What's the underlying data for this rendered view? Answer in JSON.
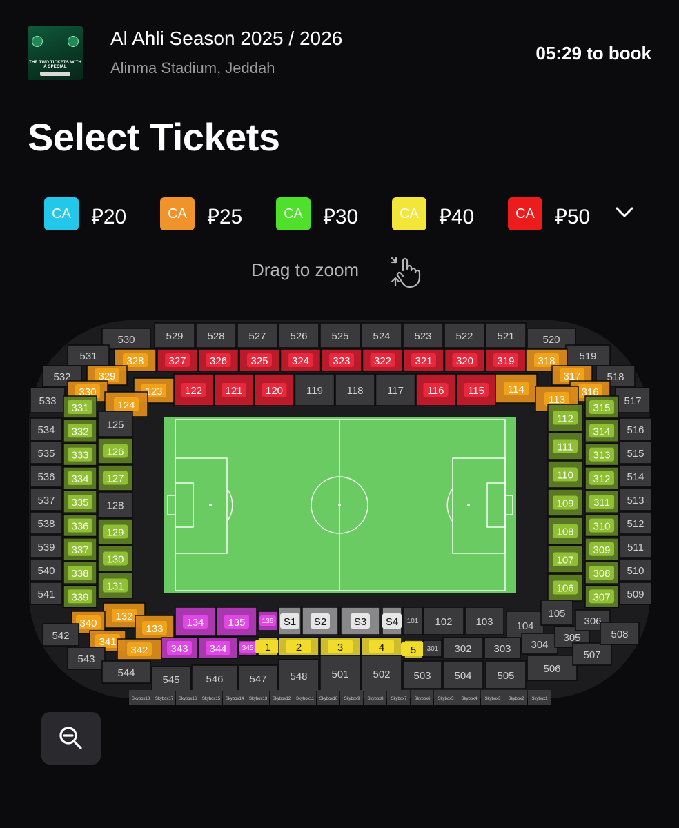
{
  "event": {
    "title": "Al Ahli Season 2025 / 2026",
    "venue": "Alinma Stadium, Jeddah",
    "timer": "05:29 to book",
    "thumbnail_text": "THE TWO TICKETS WITH A SPECIAL"
  },
  "page": {
    "heading": "Select Tickets"
  },
  "legend": [
    {
      "code": "CA",
      "price": "⃁20",
      "color": "#22c7ea"
    },
    {
      "code": "CA",
      "price": "⃁25",
      "color": "#f0932b"
    },
    {
      "code": "CA",
      "price": "⃁30",
      "color": "#4ee02a"
    },
    {
      "code": "CA",
      "price": "⃁40",
      "color": "#f2e63a"
    },
    {
      "code": "CA",
      "price": "⃁50",
      "color": "#ec1c1c"
    }
  ],
  "legend_expand_icon": "chevron-down-icon",
  "zoom_hint": {
    "text": "Drag to zoom",
    "icon": "pinch-hand-icon"
  },
  "zoom_button_icon": "zoom-out-icon",
  "colors": {
    "gray": "#3a3a3c",
    "gray_dark": "#2b2b2d",
    "red": "#c21b2c",
    "orange": "#d98a1c",
    "green": "#5e7d24",
    "magenta": "#b13ab7",
    "yellow": "#d7c52c",
    "silver": "#8e8e91",
    "pitch": "#6acb63"
  },
  "seat_map": {
    "sections": [
      {
        "id": "529",
        "status": "gray"
      },
      {
        "id": "528",
        "status": "gray"
      },
      {
        "id": "527",
        "status": "gray"
      },
      {
        "id": "526",
        "status": "gray"
      },
      {
        "id": "525",
        "status": "gray"
      },
      {
        "id": "524",
        "status": "gray"
      },
      {
        "id": "523",
        "status": "gray"
      },
      {
        "id": "522",
        "status": "gray"
      },
      {
        "id": "521",
        "status": "gray"
      },
      {
        "id": "530",
        "status": "gray"
      },
      {
        "id": "520",
        "status": "gray"
      },
      {
        "id": "531",
        "status": "gray"
      },
      {
        "id": "519",
        "status": "gray"
      },
      {
        "id": "532",
        "status": "gray"
      },
      {
        "id": "518",
        "status": "gray"
      },
      {
        "id": "533",
        "status": "gray"
      },
      {
        "id": "517",
        "status": "gray"
      },
      {
        "id": "327",
        "status": "red"
      },
      {
        "id": "326",
        "status": "red"
      },
      {
        "id": "325",
        "status": "red"
      },
      {
        "id": "324",
        "status": "red"
      },
      {
        "id": "323",
        "status": "red"
      },
      {
        "id": "322",
        "status": "red"
      },
      {
        "id": "321",
        "status": "red"
      },
      {
        "id": "320",
        "status": "red"
      },
      {
        "id": "319",
        "status": "red"
      },
      {
        "id": "328",
        "status": "orange"
      },
      {
        "id": "329",
        "status": "orange"
      },
      {
        "id": "330",
        "status": "orange"
      },
      {
        "id": "318",
        "status": "orange"
      },
      {
        "id": "317",
        "status": "orange"
      },
      {
        "id": "316",
        "status": "orange"
      },
      {
        "id": "122",
        "status": "red"
      },
      {
        "id": "121",
        "status": "red"
      },
      {
        "id": "120",
        "status": "red"
      },
      {
        "id": "119",
        "status": "gray"
      },
      {
        "id": "118",
        "status": "gray"
      },
      {
        "id": "117",
        "status": "gray"
      },
      {
        "id": "116",
        "status": "red"
      },
      {
        "id": "115",
        "status": "red"
      },
      {
        "id": "123",
        "status": "orange"
      },
      {
        "id": "124",
        "status": "orange"
      },
      {
        "id": "114",
        "status": "orange"
      },
      {
        "id": "113",
        "status": "orange"
      },
      {
        "id": "534",
        "status": "gray"
      },
      {
        "id": "535",
        "status": "gray"
      },
      {
        "id": "536",
        "status": "gray"
      },
      {
        "id": "537",
        "status": "gray"
      },
      {
        "id": "538",
        "status": "gray"
      },
      {
        "id": "539",
        "status": "gray"
      },
      {
        "id": "540",
        "status": "gray"
      },
      {
        "id": "541",
        "status": "gray"
      },
      {
        "id": "331",
        "status": "green"
      },
      {
        "id": "332",
        "status": "green"
      },
      {
        "id": "333",
        "status": "green"
      },
      {
        "id": "334",
        "status": "green"
      },
      {
        "id": "335",
        "status": "green"
      },
      {
        "id": "336",
        "status": "green"
      },
      {
        "id": "337",
        "status": "green"
      },
      {
        "id": "338",
        "status": "green"
      },
      {
        "id": "339",
        "status": "green"
      },
      {
        "id": "125",
        "status": "gray"
      },
      {
        "id": "126",
        "status": "green"
      },
      {
        "id": "127",
        "status": "green"
      },
      {
        "id": "128",
        "status": "gray"
      },
      {
        "id": "129",
        "status": "green"
      },
      {
        "id": "130",
        "status": "green"
      },
      {
        "id": "131",
        "status": "green"
      },
      {
        "id": "112",
        "status": "green"
      },
      {
        "id": "111",
        "status": "green"
      },
      {
        "id": "110",
        "status": "green"
      },
      {
        "id": "109",
        "status": "green"
      },
      {
        "id": "108",
        "status": "green"
      },
      {
        "id": "107",
        "status": "green"
      },
      {
        "id": "106",
        "status": "green"
      },
      {
        "id": "315",
        "status": "green"
      },
      {
        "id": "314",
        "status": "green"
      },
      {
        "id": "313",
        "status": "green"
      },
      {
        "id": "312",
        "status": "green"
      },
      {
        "id": "311",
        "status": "green"
      },
      {
        "id": "310",
        "status": "green"
      },
      {
        "id": "309",
        "status": "green"
      },
      {
        "id": "308",
        "status": "green"
      },
      {
        "id": "307",
        "status": "green"
      },
      {
        "id": "516",
        "status": "gray"
      },
      {
        "id": "515",
        "status": "gray"
      },
      {
        "id": "514",
        "status": "gray"
      },
      {
        "id": "513",
        "status": "gray"
      },
      {
        "id": "512",
        "status": "gray"
      },
      {
        "id": "511",
        "status": "gray"
      },
      {
        "id": "510",
        "status": "gray"
      },
      {
        "id": "509",
        "status": "gray"
      },
      {
        "id": "132",
        "status": "orange"
      },
      {
        "id": "133",
        "status": "orange"
      },
      {
        "id": "340",
        "status": "orange"
      },
      {
        "id": "341",
        "status": "orange"
      },
      {
        "id": "342",
        "status": "orange"
      },
      {
        "id": "134",
        "status": "magenta"
      },
      {
        "id": "135",
        "status": "magenta"
      },
      {
        "id": "136",
        "status": "magenta"
      },
      {
        "id": "343",
        "status": "magenta"
      },
      {
        "id": "344",
        "status": "magenta"
      },
      {
        "id": "345",
        "status": "magenta"
      },
      {
        "id": "S1",
        "status": "silver"
      },
      {
        "id": "S2",
        "status": "silver"
      },
      {
        "id": "S3",
        "status": "silver"
      },
      {
        "id": "S4",
        "status": "silver"
      },
      {
        "id": "1",
        "status": "yellow"
      },
      {
        "id": "2",
        "status": "yellow"
      },
      {
        "id": "3",
        "status": "yellow"
      },
      {
        "id": "4",
        "status": "yellow"
      },
      {
        "id": "5",
        "status": "yellow"
      },
      {
        "id": "101",
        "status": "gray"
      },
      {
        "id": "102",
        "status": "gray"
      },
      {
        "id": "103",
        "status": "gray"
      },
      {
        "id": "104",
        "status": "gray"
      },
      {
        "id": "105",
        "status": "gray"
      },
      {
        "id": "301",
        "status": "gray"
      },
      {
        "id": "302",
        "status": "gray"
      },
      {
        "id": "303",
        "status": "gray"
      },
      {
        "id": "304",
        "status": "gray"
      },
      {
        "id": "305",
        "status": "gray"
      },
      {
        "id": "306",
        "status": "gray"
      },
      {
        "id": "542",
        "status": "gray"
      },
      {
        "id": "543",
        "status": "gray"
      },
      {
        "id": "544",
        "status": "gray"
      },
      {
        "id": "545",
        "status": "gray"
      },
      {
        "id": "546",
        "status": "gray"
      },
      {
        "id": "547",
        "status": "gray"
      },
      {
        "id": "548",
        "status": "gray"
      },
      {
        "id": "501",
        "status": "gray"
      },
      {
        "id": "502",
        "status": "gray"
      },
      {
        "id": "503",
        "status": "gray"
      },
      {
        "id": "504",
        "status": "gray"
      },
      {
        "id": "505",
        "status": "gray"
      },
      {
        "id": "506",
        "status": "gray"
      },
      {
        "id": "507",
        "status": "gray"
      },
      {
        "id": "508",
        "status": "gray"
      }
    ],
    "skyboxes": [
      "Skybox18",
      "Skybox17",
      "Skybox16",
      "Skybox15",
      "Skybox14",
      "Skybox13",
      "Skybox12",
      "Skybox11",
      "Skybox10",
      "Skybox9",
      "Skybox8",
      "Skybox7",
      "Skybox6",
      "Skybox5",
      "Skybox4",
      "Skybox3",
      "Skybox2",
      "Skybox1"
    ]
  }
}
